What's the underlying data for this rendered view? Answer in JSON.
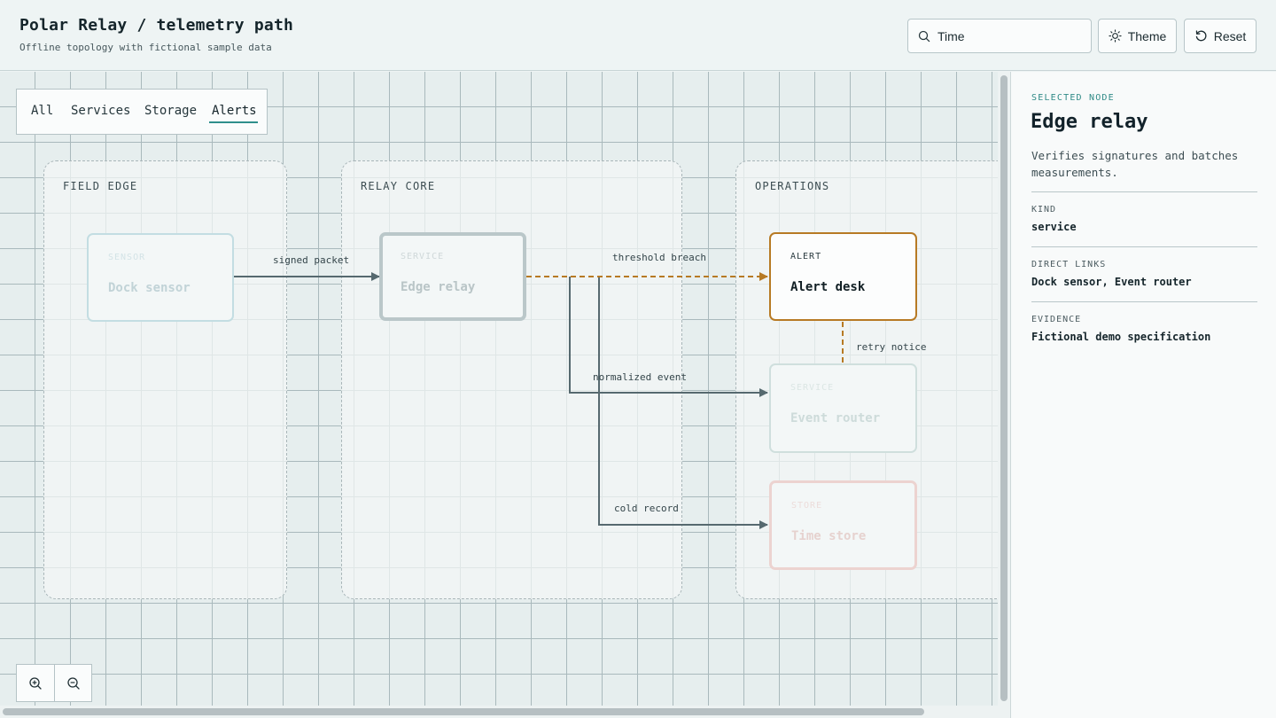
{
  "header": {
    "title": "Polar Relay / telemetry path",
    "subtitle": "Offline topology with fictional sample data",
    "search": {
      "value": "Time",
      "icon": "search-icon"
    },
    "theme_label": "Theme",
    "reset_label": "Reset"
  },
  "filters": {
    "tabs": [
      "All",
      "Services",
      "Storage",
      "Alerts"
    ],
    "active": "Alerts"
  },
  "groups": {
    "field_edge": "FIELD EDGE",
    "relay_core": "RELAY CORE",
    "operations": "OPERATIONS"
  },
  "nodes": {
    "dock_sensor": {
      "kind": "SENSOR",
      "name": "Dock sensor"
    },
    "edge_relay": {
      "kind": "SERVICE",
      "name": "Edge relay"
    },
    "alert_desk": {
      "kind": "ALERT",
      "name": "Alert desk"
    },
    "event_router": {
      "kind": "SERVICE",
      "name": "Event router"
    },
    "time_store": {
      "kind": "STORE",
      "name": "Time store"
    }
  },
  "edges": {
    "signed_packet": "signed packet",
    "threshold_breach": "threshold breach",
    "retry_notice": "retry notice",
    "normalized_event": "normalized event",
    "cold_record": "cold record"
  },
  "colors": {
    "accent": "#2f8f8c",
    "alert": "#b77a24",
    "edge_line": "#56696f"
  },
  "inspector": {
    "eyebrow": "SELECTED NODE",
    "title": "Edge relay",
    "description": "Verifies signatures and batches measurements.",
    "kind_label": "KIND",
    "kind_value": "service",
    "links_label": "DIRECT LINKS",
    "links_value": "Dock sensor, Event router",
    "evidence_label": "EVIDENCE",
    "evidence_value": "Fictional demo specification"
  },
  "zoom": {
    "in_icon": "zoom-in-icon",
    "out_icon": "zoom-out-icon"
  }
}
